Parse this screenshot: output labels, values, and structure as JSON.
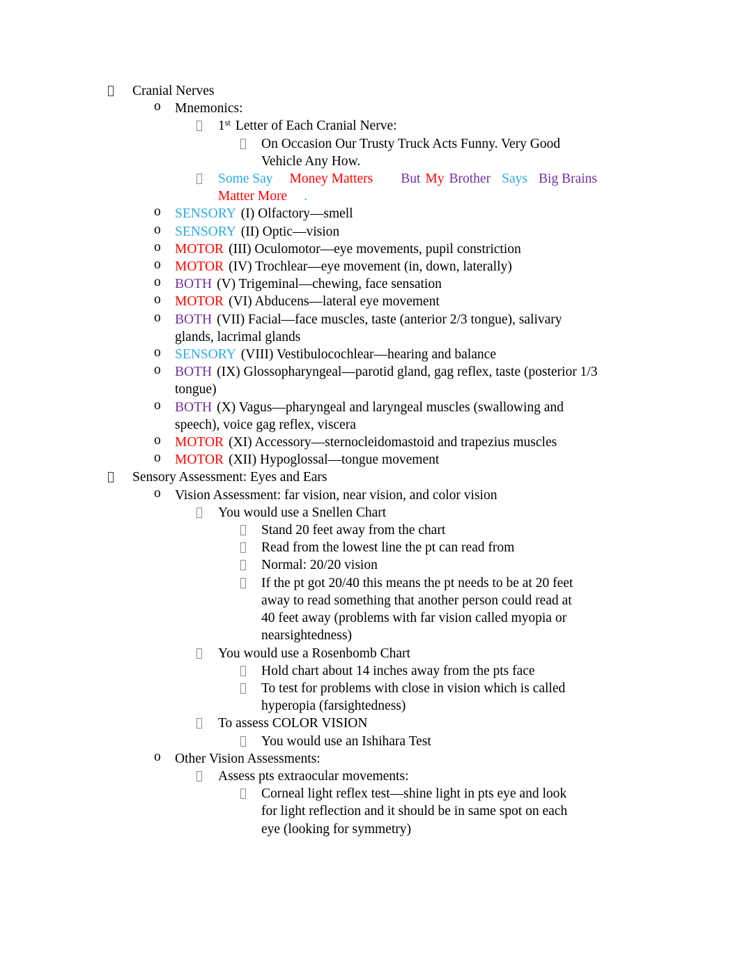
{
  "document": {
    "bullet_glyph_level1": "tofu-box",
    "bullet_glyph_level2": "o",
    "bullet_glyph_level3": "tofu-box",
    "bullet_glyph_level4": "tofu-box",
    "colors": {
      "sensory": "#29abe2",
      "motor": "#ff0000",
      "both": "#7030a0",
      "body_text": "#000000"
    },
    "bullet_o": "o"
  },
  "outline": {
    "cranial_nerves_heading": "Cranial Nerves",
    "mnemonics_heading": "Mnemonics:",
    "first_letter_heading_pre": "1",
    "first_letter_heading_sup": "st",
    "first_letter_heading_post": "Letter of Each Cranial Nerve:",
    "occasion_mnemonic": "On Occasion Our Trusty Truck Acts Funny. Very Good Vehicle Any How.",
    "sensory_mnemonic": {
      "part1": "Some Say",
      "part2": "Money Matters",
      "part3": "But",
      "part4": "My",
      "part5": "Brother",
      "part6": "Says",
      "part7": "Big Brains",
      "part8": "Matter More",
      "part9": "."
    },
    "nerves": [
      {
        "type": "SENSORY",
        "text": "(I) Olfactory—smell"
      },
      {
        "type": "SENSORY",
        "text": "(II) Optic—vision"
      },
      {
        "type": "MOTOR",
        "text": "(III) Oculomotor—eye movements, pupil constriction"
      },
      {
        "type": "MOTOR",
        "text": "(IV) Trochlear—eye movement (in, down, laterally)"
      },
      {
        "type": "BOTH",
        "text": "(V) Trigeminal—chewing, face sensation"
      },
      {
        "type": "MOTOR",
        "text": "(VI) Abducens—lateral eye movement"
      },
      {
        "type": "BOTH",
        "text": "(VII) Facial—face muscles, taste (anterior 2/3 tongue), salivary glands, lacrimal glands"
      },
      {
        "type": "SENSORY",
        "text": "(VIII) Vestibulocochlear—hearing and balance"
      },
      {
        "type": "BOTH",
        "text": "(IX) Glossopharyngeal—parotid gland, gag reflex, taste (posterior 1/3 tongue)"
      },
      {
        "type": "BOTH",
        "text": "(X) Vagus—pharyngeal and laryngeal muscles (swallowing and speech), voice gag reflex, viscera"
      },
      {
        "type": "MOTOR",
        "text": "(XI) Accessory—sternocleidomastoid and trapezius muscles"
      },
      {
        "type": "MOTOR",
        "text": "(XII) Hypoglossal—tongue movement"
      }
    ],
    "sensory_assessment_heading": "Sensory Assessment: Eyes and Ears",
    "vision_assessment_heading": "Vision Assessment: far vision, near vision, and color vision",
    "snellen_heading": "You would use a Snellen Chart",
    "snellen_points": [
      "Stand 20 feet away from the chart",
      "Read from the lowest line the pt can read from",
      "Normal: 20/20 vision",
      "If the pt got 20/40 this means the pt needs to be at 20 feet away to read something that another person could read at 40 feet away (problems with far vision called myopia or nearsightedness)"
    ],
    "rosenbomb_heading": "You would use a Rosenbomb Chart",
    "rosenbomb_points": [
      "Hold chart about 14 inches away from the pts face",
      "To test for problems with close in vision which is called hyperopia (farsightedness)"
    ],
    "color_vision_heading": "To assess COLOR VISION",
    "color_vision_points": [
      "You would use an Ishihara Test"
    ],
    "other_vision_heading": "Other Vision Assessments:",
    "extraocular_heading": "Assess pts extraocular movements:",
    "extraocular_points": [
      "Corneal light reflex test—shine light in pts eye and look for light reflection and it should be in same spot on each eye (looking for symmetry)"
    ]
  }
}
